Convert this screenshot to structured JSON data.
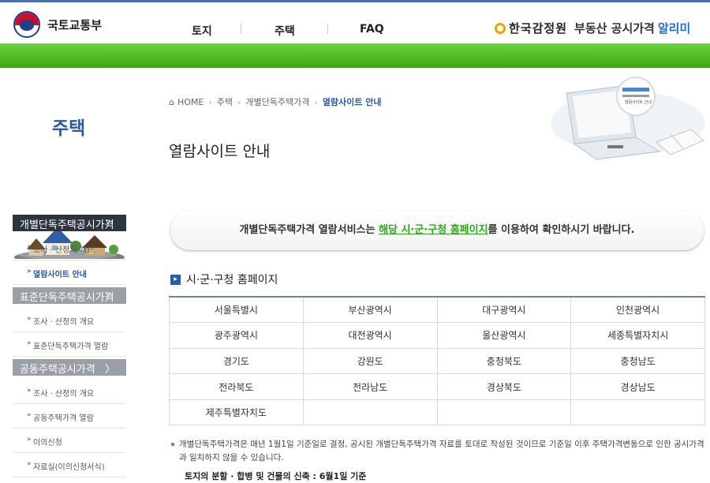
{
  "header": {
    "ministry": "국토교통부",
    "menu": [
      "토지",
      "주택",
      "FAQ"
    ],
    "agency": "한국감정원",
    "service_prefix": "부동산 공시가격",
    "service_accent": "알리미"
  },
  "sidebar": {
    "title": "주택",
    "menus": [
      {
        "label": "개별단독주택공시가격",
        "chev": "〉",
        "sub": [
          "조사 · 산정의 개요",
          "열람사이트 안내"
        ]
      },
      {
        "label": "표준단독주택공시가격",
        "chev": "〉",
        "sub": [
          "조사 · 산정의 개요",
          "표준단독주택가격 열람"
        ]
      },
      {
        "label": "공동주택공시가격",
        "chev": "〉",
        "sub": [
          "조사 · 산정의 개요",
          "공동주택가격 열람",
          "이의신청",
          "자료실(이의신청서식)"
        ]
      }
    ]
  },
  "breadcrumb": [
    "HOME",
    "주택",
    "개별단독주택가격",
    "열람사이트 안내"
  ],
  "illustration_label": "열람사이트 안내",
  "page_title": "열람사이트 안내",
  "notice": {
    "before": "개별단독주택가격 열람서비스는 ",
    "highlight": "해당 시·군·구청 홈페이지",
    "after": "를 이용하여 확인하시기 바랍니다."
  },
  "section_title": "시·군·구청 홈페이지",
  "regions": [
    [
      "서울특별시",
      "부산광역시",
      "대구광역시",
      "인천광역시"
    ],
    [
      "광주광역시",
      "대전광역시",
      "울산광역시",
      "세종특별자치시"
    ],
    [
      "경기도",
      "강원도",
      "충청북도",
      "충청남도"
    ],
    [
      "전라북도",
      "전라남도",
      "경상북도",
      "경상남도"
    ],
    [
      "제주특별자치도",
      "",
      "",
      ""
    ]
  ],
  "footnote": "개별단독주택가격은 매년 1월1일 기준일로 결정, 공시된 개별단독주택가격 자료를 토대로 작성된 것이므로 기준일 이후 주택가격변동으로 인한 공시가격과 일치하지 않을 수 있습니다.",
  "footnote_bold": "토지의 분할 · 합병 및 건물의 신축 : 6월1일 기준",
  "colors": {
    "accent_blue": "#2a5aa8",
    "green_bar": "#4fbd1f",
    "highlight_green": "#2ea91d",
    "sidebar_dark": "#2f3540",
    "sidebar_grey": "#9aa0a6"
  },
  "icons": {
    "home": "home-icon",
    "section": "square-chevron-right-icon",
    "menu_chevron": "chevron-right-icon"
  }
}
